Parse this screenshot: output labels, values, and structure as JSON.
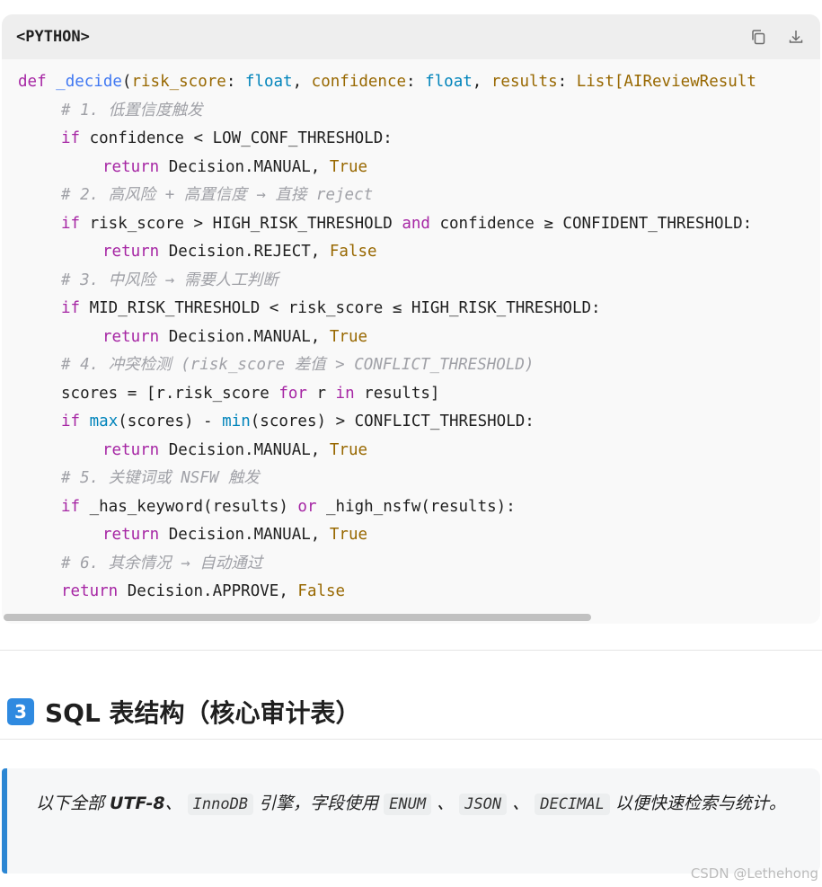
{
  "code_block": {
    "language": "<PYTHON>",
    "copy_icon": "copy-icon",
    "download_icon": "download-icon",
    "lines": [
      {
        "indent": 0,
        "tokens": [
          {
            "t": "def",
            "c": "kw"
          },
          {
            "t": " "
          },
          {
            "t": "_decide",
            "c": "fn"
          },
          {
            "t": "("
          },
          {
            "t": "risk_score",
            "c": "pm"
          },
          {
            "t": ": "
          },
          {
            "t": "float",
            "c": "ty"
          },
          {
            "t": ", "
          },
          {
            "t": "confidence",
            "c": "pm"
          },
          {
            "t": ": "
          },
          {
            "t": "float",
            "c": "ty"
          },
          {
            "t": ", "
          },
          {
            "t": "results",
            "c": "pm"
          },
          {
            "t": ": "
          },
          {
            "t": "List[AIReviewResult",
            "c": "pm"
          }
        ]
      },
      {
        "indent": 1,
        "tokens": [
          {
            "t": "# 1. 低置信度触发",
            "c": "cm"
          }
        ]
      },
      {
        "indent": 1,
        "tokens": [
          {
            "t": "if",
            "c": "kw"
          },
          {
            "t": " confidence < LOW_CONF_THRESHOLD:"
          }
        ]
      },
      {
        "indent": 2,
        "tokens": [
          {
            "t": "return",
            "c": "kw"
          },
          {
            "t": " Decision.MANUAL, "
          },
          {
            "t": "True",
            "c": "bl"
          }
        ]
      },
      {
        "indent": 1,
        "tokens": [
          {
            "t": "# 2. 高风险 + 高置信度 → 直接 reject",
            "c": "cm"
          }
        ]
      },
      {
        "indent": 1,
        "tokens": [
          {
            "t": "if",
            "c": "kw"
          },
          {
            "t": " risk_score > HIGH_RISK_THRESHOLD "
          },
          {
            "t": "and",
            "c": "kw"
          },
          {
            "t": " confidence ≥ CONFIDENT_THRESHOLD:"
          }
        ]
      },
      {
        "indent": 2,
        "tokens": [
          {
            "t": "return",
            "c": "kw"
          },
          {
            "t": " Decision.REJECT, "
          },
          {
            "t": "False",
            "c": "bl"
          }
        ]
      },
      {
        "indent": 1,
        "tokens": [
          {
            "t": "# 3. 中风险 → 需要人工判断",
            "c": "cm"
          }
        ]
      },
      {
        "indent": 1,
        "tokens": [
          {
            "t": "if",
            "c": "kw"
          },
          {
            "t": " MID_RISK_THRESHOLD < risk_score ≤ HIGH_RISK_THRESHOLD:"
          }
        ]
      },
      {
        "indent": 2,
        "tokens": [
          {
            "t": "return",
            "c": "kw"
          },
          {
            "t": " Decision.MANUAL, "
          },
          {
            "t": "True",
            "c": "bl"
          }
        ]
      },
      {
        "indent": 1,
        "tokens": [
          {
            "t": "# 4. 冲突检测 (risk_score 差值 > CONFLICT_THRESHOLD)",
            "c": "cm"
          }
        ]
      },
      {
        "indent": 1,
        "tokens": [
          {
            "t": "scores = [r.risk_score "
          },
          {
            "t": "for",
            "c": "kw"
          },
          {
            "t": " r "
          },
          {
            "t": "in",
            "c": "kw"
          },
          {
            "t": " results]"
          }
        ]
      },
      {
        "indent": 1,
        "tokens": [
          {
            "t": "if",
            "c": "kw"
          },
          {
            "t": " "
          },
          {
            "t": "max",
            "c": "ty"
          },
          {
            "t": "(scores) - "
          },
          {
            "t": "min",
            "c": "ty"
          },
          {
            "t": "(scores) > CONFLICT_THRESHOLD:"
          }
        ]
      },
      {
        "indent": 2,
        "tokens": [
          {
            "t": "return",
            "c": "kw"
          },
          {
            "t": " Decision.MANUAL, "
          },
          {
            "t": "True",
            "c": "bl"
          }
        ]
      },
      {
        "indent": 1,
        "tokens": [
          {
            "t": "# 5. 关键词或 NSFW 触发",
            "c": "cm"
          }
        ]
      },
      {
        "indent": 1,
        "tokens": [
          {
            "t": "if",
            "c": "kw"
          },
          {
            "t": " _has_keyword(results) "
          },
          {
            "t": "or",
            "c": "kw"
          },
          {
            "t": " _high_nsfw(results):"
          }
        ]
      },
      {
        "indent": 2,
        "tokens": [
          {
            "t": "return",
            "c": "kw"
          },
          {
            "t": " Decision.MANUAL, "
          },
          {
            "t": "True",
            "c": "bl"
          }
        ]
      },
      {
        "indent": 1,
        "tokens": [
          {
            "t": "# 6. 其余情况 → 自动通过",
            "c": "cm"
          }
        ]
      },
      {
        "indent": 1,
        "tokens": [
          {
            "t": "return",
            "c": "kw"
          },
          {
            "t": " Decision.APPROVE, "
          },
          {
            "t": "False",
            "c": "bl"
          }
        ]
      }
    ]
  },
  "section": {
    "badge": "3",
    "title": "SQL 表结构（核心审计表）"
  },
  "note": {
    "p1": "以下全部 ",
    "bold": "UTF-8",
    "p2": "、 ",
    "code1": "InnoDB",
    "p3": " 引擎，字段使用 ",
    "code2": "ENUM",
    "p4": " 、 ",
    "code3": "JSON",
    "p5": " 、 ",
    "code4": "DECIMAL",
    "p6": " 以便快速检索与统计。"
  },
  "watermark": "CSDN @Lethehong",
  "colors": {
    "keyword": "#a626a4",
    "function": "#4078f2",
    "builtin": "#0184bb",
    "param": "#986801",
    "comment": "#a0a1a7",
    "accent": "#2b86d3"
  }
}
